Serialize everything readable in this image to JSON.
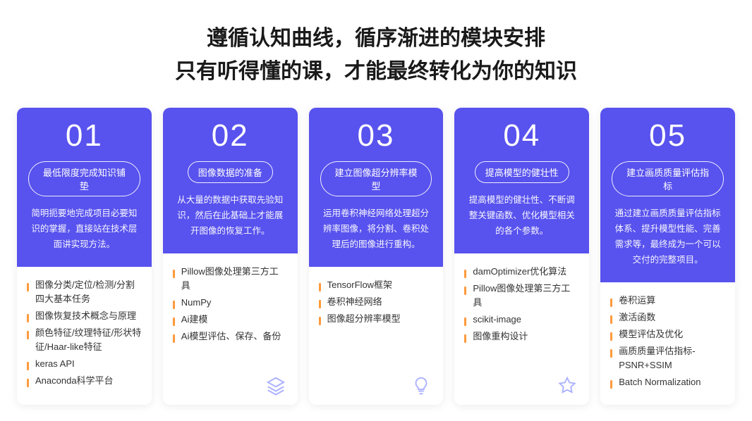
{
  "hero": {
    "line1": "遵循认知曲线，循序渐进的模块安排",
    "line2": "只有听得懂的课，才能最终转化为你的知识"
  },
  "cards": [
    {
      "num": "01",
      "badge": "最低限度完成知识铺垫",
      "desc": "简明扼要地完成项目必要知识的掌握，直接站在技术层面讲实现方法。",
      "items": [
        "图像分类/定位/检测/分割四大基本任务",
        "图像恢复技术概念与原理",
        "颜色特征/纹理特征/形状特征/Haar-like特征",
        "keras API",
        "Anaconda科学平台"
      ]
    },
    {
      "num": "02",
      "badge": "图像数据的准备",
      "desc": "从大量的数据中获取先验知识，然后在此基础上才能展开图像的恢复工作。",
      "items": [
        "Pillow图像处理第三方工具",
        "NumPy",
        "Ai建模",
        "Ai模型评估、保存、备份"
      ],
      "icon": "layers"
    },
    {
      "num": "03",
      "badge": "建立图像超分辨率模型",
      "desc": "运用卷积神经网络处理超分辨率图像，将分割、卷积处理后的图像进行重构。",
      "items": [
        "TensorFlow框架",
        "卷积神经网络",
        "图像超分辨率模型"
      ],
      "icon": "bulb"
    },
    {
      "num": "04",
      "badge": "提高模型的健壮性",
      "desc": "提高模型的健壮性、不断调整关键函数、优化模型相关的各个参数。",
      "items": [
        "damOptimizer优化算法",
        "Pillow图像处理第三方工具",
        "scikit-image",
        "图像重构设计"
      ],
      "icon": "star"
    },
    {
      "num": "05",
      "badge": "建立画质质量评估指标",
      "desc": "通过建立画质质量评估指标体系、提升模型性能、完善需求等，最终成为一个可以交付的完整项目。",
      "items": [
        "卷积运算",
        "激活函数",
        "模型评估及优化",
        "画质质量评估指标-PSNR+SSIM",
        "Batch Normalization"
      ]
    }
  ]
}
